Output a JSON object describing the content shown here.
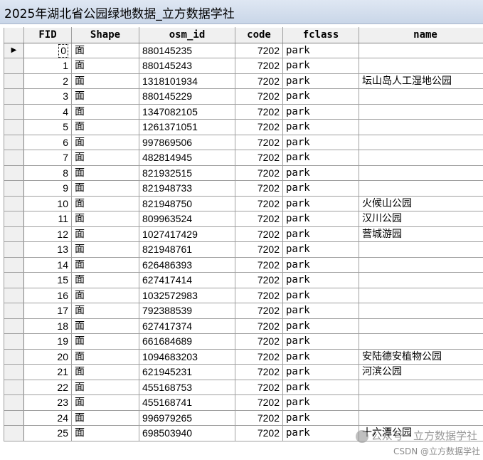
{
  "window": {
    "title": "2025年湖北省公园绿地数据_立方数据学社"
  },
  "table": {
    "columns": [
      "FID",
      "Shape",
      "osm_id",
      "code",
      "fclass",
      "name"
    ],
    "current_row_marker": "▶",
    "rows": [
      {
        "fid": "0",
        "shape": "面",
        "osm_id": "880145235",
        "code": "7202",
        "fclass": "park",
        "name": ""
      },
      {
        "fid": "1",
        "shape": "面",
        "osm_id": "880145243",
        "code": "7202",
        "fclass": "park",
        "name": ""
      },
      {
        "fid": "2",
        "shape": "面",
        "osm_id": "1318101934",
        "code": "7202",
        "fclass": "park",
        "name": "坛山岛人工湿地公园"
      },
      {
        "fid": "3",
        "shape": "面",
        "osm_id": "880145229",
        "code": "7202",
        "fclass": "park",
        "name": ""
      },
      {
        "fid": "4",
        "shape": "面",
        "osm_id": "1347082105",
        "code": "7202",
        "fclass": "park",
        "name": ""
      },
      {
        "fid": "5",
        "shape": "面",
        "osm_id": "1261371051",
        "code": "7202",
        "fclass": "park",
        "name": ""
      },
      {
        "fid": "6",
        "shape": "面",
        "osm_id": "997869506",
        "code": "7202",
        "fclass": "park",
        "name": ""
      },
      {
        "fid": "7",
        "shape": "面",
        "osm_id": "482814945",
        "code": "7202",
        "fclass": "park",
        "name": ""
      },
      {
        "fid": "8",
        "shape": "面",
        "osm_id": "821932515",
        "code": "7202",
        "fclass": "park",
        "name": ""
      },
      {
        "fid": "9",
        "shape": "面",
        "osm_id": "821948733",
        "code": "7202",
        "fclass": "park",
        "name": ""
      },
      {
        "fid": "10",
        "shape": "面",
        "osm_id": "821948750",
        "code": "7202",
        "fclass": "park",
        "name": "火候山公园"
      },
      {
        "fid": "11",
        "shape": "面",
        "osm_id": "809963524",
        "code": "7202",
        "fclass": "park",
        "name": "汉川公园"
      },
      {
        "fid": "12",
        "shape": "面",
        "osm_id": "1027417429",
        "code": "7202",
        "fclass": "park",
        "name": "营城游园"
      },
      {
        "fid": "13",
        "shape": "面",
        "osm_id": "821948761",
        "code": "7202",
        "fclass": "park",
        "name": ""
      },
      {
        "fid": "14",
        "shape": "面",
        "osm_id": "626486393",
        "code": "7202",
        "fclass": "park",
        "name": ""
      },
      {
        "fid": "15",
        "shape": "面",
        "osm_id": "627417414",
        "code": "7202",
        "fclass": "park",
        "name": ""
      },
      {
        "fid": "16",
        "shape": "面",
        "osm_id": "1032572983",
        "code": "7202",
        "fclass": "park",
        "name": ""
      },
      {
        "fid": "17",
        "shape": "面",
        "osm_id": "792388539",
        "code": "7202",
        "fclass": "park",
        "name": ""
      },
      {
        "fid": "18",
        "shape": "面",
        "osm_id": "627417374",
        "code": "7202",
        "fclass": "park",
        "name": ""
      },
      {
        "fid": "19",
        "shape": "面",
        "osm_id": "661684689",
        "code": "7202",
        "fclass": "park",
        "name": ""
      },
      {
        "fid": "20",
        "shape": "面",
        "osm_id": "1094683203",
        "code": "7202",
        "fclass": "park",
        "name": "安陆德安植物公园"
      },
      {
        "fid": "21",
        "shape": "面",
        "osm_id": "621945231",
        "code": "7202",
        "fclass": "park",
        "name": "河滨公园"
      },
      {
        "fid": "22",
        "shape": "面",
        "osm_id": "455168753",
        "code": "7202",
        "fclass": "park",
        "name": ""
      },
      {
        "fid": "23",
        "shape": "面",
        "osm_id": "455168741",
        "code": "7202",
        "fclass": "park",
        "name": ""
      },
      {
        "fid": "24",
        "shape": "面",
        "osm_id": "996979265",
        "code": "7202",
        "fclass": "park",
        "name": ""
      },
      {
        "fid": "25",
        "shape": "面",
        "osm_id": "698503940",
        "code": "7202",
        "fclass": "park",
        "name": "十六潭公园"
      }
    ]
  },
  "watermark": {
    "line1": "公众号 · 立方数据学社",
    "line2": "CSDN @立方数据学社"
  }
}
